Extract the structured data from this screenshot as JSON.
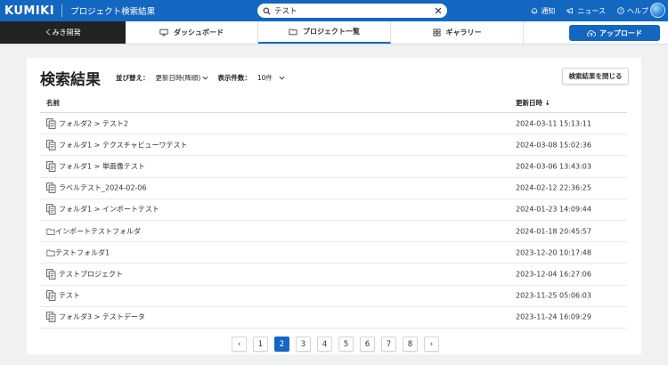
{
  "header": {
    "logo": "KUMIKI",
    "app_title": "プロジェクト検索結果",
    "search": {
      "value": "テスト",
      "placeholder": ""
    },
    "links": {
      "notification": "通知",
      "news": "ニュース",
      "help": "ヘルプ"
    }
  },
  "nav": {
    "home": "くみき開発",
    "tabs": [
      {
        "label": "ダッシュボード",
        "icon": "monitor-icon"
      },
      {
        "label": "プロジェクト一覧",
        "icon": "folder-icon",
        "active": true
      },
      {
        "label": "ギャラリー",
        "icon": "grid-icon"
      }
    ],
    "upload": "アップロード"
  },
  "main": {
    "title": "検索結果",
    "sort_label": "並び替え：",
    "sort_value": "更新日時(降順)",
    "count_label": "表示件数：",
    "count_value": "10件",
    "close_button": "検索結果を閉じる",
    "columns": {
      "name": "名前",
      "date": "更新日時 ↓"
    },
    "rows": [
      {
        "name": "フォルダ2 > テスト2",
        "date": "2024-03-11 15:13:11",
        "icon": "copy-icon"
      },
      {
        "name": "フォルダ1 > テクスチャビューワテスト",
        "date": "2024-03-08 15:02:36",
        "icon": "copy-icon"
      },
      {
        "name": "フォルダ1 > 単画像テスト",
        "date": "2024-03-06 13:43:03",
        "icon": "copy-icon"
      },
      {
        "name": "ラベルテスト_2024-02-06",
        "date": "2024-02-12 22:36:25",
        "icon": "copy-icon"
      },
      {
        "name": "フォルダ1 > インポートテスト",
        "date": "2024-01-23 14:09:44",
        "icon": "copy-icon"
      },
      {
        "name": "インポートテストフォルダ",
        "date": "2024-01-18 20:45:57",
        "icon": "folder-icon"
      },
      {
        "name": "テストフォルダ1",
        "date": "2023-12-20 10:17:48",
        "icon": "folder-icon"
      },
      {
        "name": "テストプロジェクト",
        "date": "2023-12-04 16:27:06",
        "icon": "copy-icon"
      },
      {
        "name": "テスト",
        "date": "2023-11-25 05:06:03",
        "icon": "copy-icon"
      },
      {
        "name": "フォルダ3 > テストデータ",
        "date": "2023-11-24 16:09:29",
        "icon": "copy-icon"
      }
    ]
  },
  "pagination": {
    "prev": "‹",
    "next": "›",
    "pages": [
      "1",
      "2",
      "3",
      "4",
      "5",
      "6",
      "7",
      "8"
    ],
    "current": "2"
  },
  "colors": {
    "primary": "#1467c0",
    "home_tab": "#222222",
    "background": "#f0f1f3"
  }
}
